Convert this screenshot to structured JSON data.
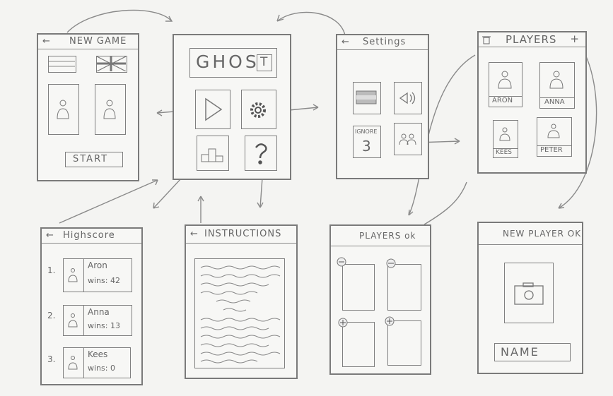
{
  "new_game": {
    "back": "←",
    "title": "NEW GAME",
    "start": "START"
  },
  "home": {
    "logo": "GHOS",
    "logo_last": "T"
  },
  "settings": {
    "back": "←",
    "title": "Settings",
    "ignore_label": "IGNORE",
    "ignore_value": "3"
  },
  "players": {
    "title": "PLAYERS",
    "add": "+",
    "names": [
      "ARON",
      "ANNA",
      "KEES",
      "PETER"
    ]
  },
  "highscore": {
    "back": "←",
    "title": "Highscore",
    "entries": [
      {
        "rank": "1.",
        "name": "Aron",
        "wins": "wins: 42"
      },
      {
        "rank": "2.",
        "name": "Anna",
        "wins": "wins: 13"
      },
      {
        "rank": "3.",
        "name": "Kees",
        "wins": "wins: 0"
      }
    ]
  },
  "instructions": {
    "back": "←",
    "title": "INSTRUCTIONS"
  },
  "players_ok": {
    "title": "PLAYERS ok"
  },
  "new_player": {
    "title": "NEW PLAYER OK",
    "name_field": "NAME"
  }
}
